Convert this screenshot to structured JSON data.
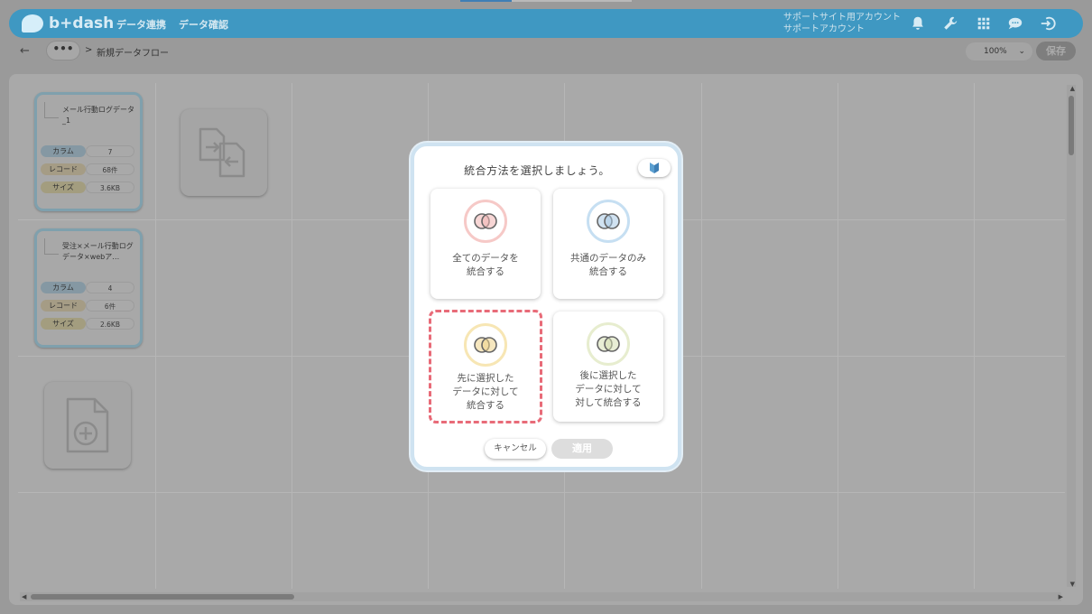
{
  "header": {
    "logo_text": "b+dash",
    "nav": [
      "データ連携",
      "データ確認"
    ],
    "account_line1": "サポートサイト用アカウント",
    "account_line2": "サポートアカウント",
    "icons": [
      "bell-icon",
      "wrench-icon",
      "grid-icon",
      "chat-icon",
      "logout-icon"
    ],
    "accent_color": "#3f98c2"
  },
  "top_progress": 0.3,
  "toolbar": {
    "back": "←",
    "more": "•••",
    "separator": ">",
    "page_title": "新規データフロー",
    "zoom": "100%",
    "save_label": "保存"
  },
  "canvas": {
    "cards": [
      {
        "title": "メール行動ログデータ_1",
        "stats": [
          {
            "label": "カラム",
            "value": "7"
          },
          {
            "label": "レコード",
            "value": "68件"
          },
          {
            "label": "サイズ",
            "value": "3.6KB"
          }
        ]
      },
      {
        "title": "受注×メール行動ログデータ×webア…",
        "stats": [
          {
            "label": "カラム",
            "value": "4"
          },
          {
            "label": "レコード",
            "value": "6件"
          },
          {
            "label": "サイズ",
            "value": "2.6KB"
          }
        ]
      }
    ],
    "tiles": [
      "merge-files-icon",
      "add-file-icon"
    ]
  },
  "modal": {
    "title": "統合方法を選択しましょう。",
    "help_icon": "beginner-mark-icon",
    "options": [
      {
        "line1": "全てのデータを",
        "line2": "統合する",
        "line3": "",
        "ring_color": "#f6c9c7",
        "fill_color": "#f0b5b2"
      },
      {
        "line1": "共通のデータのみ",
        "line2": "統合する",
        "line3": "",
        "ring_color": "#c6dff2",
        "fill_color": "#a9cbe6"
      },
      {
        "line1": "先に選択した",
        "line2": "データに対して",
        "line3": "統合する",
        "ring_color": "#f7e6b4",
        "fill_color": "#eed48b"
      },
      {
        "line1": "後に選択した",
        "line2": "データに対して",
        "line3": "対して統合する",
        "ring_color": "#e7edcf",
        "fill_color": "#d6e0b2"
      }
    ],
    "selected_index": 2,
    "cancel_label": "キャンセル",
    "apply_label": "適用"
  }
}
